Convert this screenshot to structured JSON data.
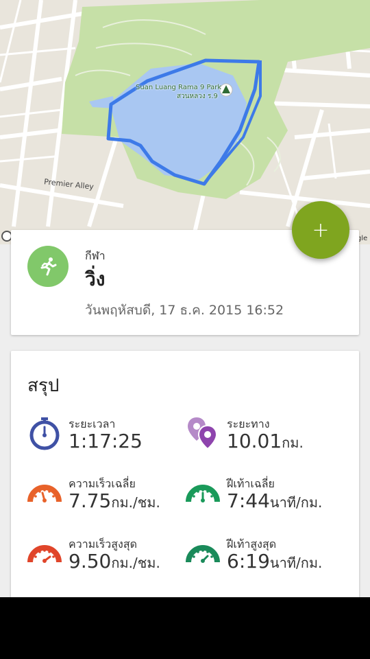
{
  "map": {
    "park_label_en": "Suan Luang Rama 9 Park",
    "park_label_th": "สวนหลวง ร.9",
    "street_label": "Premier Alley",
    "attribution": "gle",
    "colors": {
      "park": "#c6e0a7",
      "water": "#a9c7f2",
      "route": "#3d7ae8"
    }
  },
  "fab": {
    "label": "+",
    "color": "#7fa51f"
  },
  "activity": {
    "icon": "running-person-icon",
    "caption": "กีฬา",
    "sport": "วิ่ง",
    "date": "วันพฤหัสบดี, 17 ธ.ค. 2015 16:52"
  },
  "summary": {
    "title": "สรุป",
    "stats": [
      {
        "label": "ระยะเวลา",
        "value": "1:17:25",
        "unit": "",
        "icon": "stopwatch-icon",
        "color": "#3f51a5"
      },
      {
        "label": "ระยะทาง",
        "value": "10.01",
        "unit": "กม.",
        "icon": "location-pins-icon",
        "color": "#8e44ad"
      },
      {
        "label": "ความเร็วเฉลี่ย",
        "value": "7.75",
        "unit": "กม./ชม.",
        "icon": "speedometer-icon",
        "color": "#e8622a"
      },
      {
        "label": "ฝีเท้าเฉลี่ย",
        "value": "7:44",
        "unit": "นาที/กม.",
        "icon": "pace-gauge-icon",
        "color": "#1a9a5a"
      },
      {
        "label": "ความเร็วสูงสุด",
        "value": "9.50",
        "unit": "กม./ชม.",
        "icon": "speedometer-max-icon",
        "color": "#e0452a"
      },
      {
        "label": "ฝีเท้าสูงสุด",
        "value": "6:19",
        "unit": "นาที/กม.",
        "icon": "pace-gauge-max-icon",
        "color": "#1a8a5a"
      }
    ]
  }
}
